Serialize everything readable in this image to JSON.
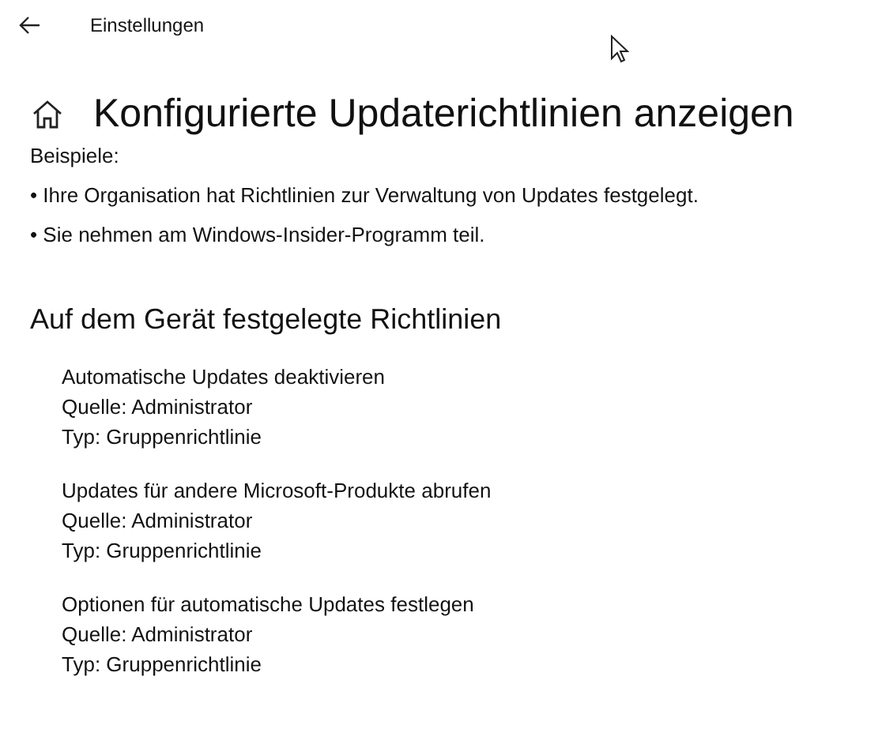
{
  "window": {
    "title": "Einstellungen"
  },
  "page": {
    "title": "Konfigurierte Updaterichtlinien anzeigen"
  },
  "intro": {
    "label": "Beispiele:",
    "bullets": [
      "• Ihre Organisation hat Richtlinien zur Verwaltung von Updates festgelegt.",
      "•  Sie nehmen am Windows-Insider-Programm teil."
    ]
  },
  "section": {
    "title": "Auf dem Gerät festgelegte Richtlinien",
    "policies": [
      {
        "name": "Automatische Updates deaktivieren",
        "source": "Quelle: Administrator",
        "type": "Typ: Gruppenrichtlinie"
      },
      {
        "name": "Updates für andere Microsoft-Produkte abrufen",
        "source": "Quelle: Administrator",
        "type": "Typ: Gruppenrichtlinie"
      },
      {
        "name": "Optionen für automatische Updates festlegen",
        "source": "Quelle: Administrator",
        "type": "Typ: Gruppenrichtlinie"
      }
    ]
  }
}
